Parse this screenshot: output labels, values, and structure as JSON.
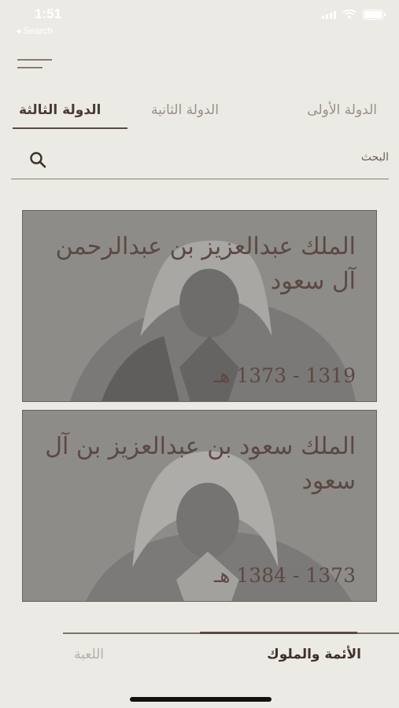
{
  "status_bar": {
    "time": "1:51",
    "back_label": "◂ Search"
  },
  "menu": {
    "icon": "hamburger-menu-icon"
  },
  "tabs": [
    {
      "label": "الدولة الأولى",
      "active": false
    },
    {
      "label": "الدولة الثانية",
      "active": false
    },
    {
      "label": "الدولة الثالثة",
      "active": true
    }
  ],
  "search": {
    "placeholder": "البحث",
    "icon": "search-icon"
  },
  "cards": [
    {
      "title": "الملك عبدالعزيز بن عبدالرحمن آل سعود",
      "years": "1319 - 1373 هـ"
    },
    {
      "title": "الملك سعود بن عبدالعزيز بن آل سعود",
      "years": "1373 - 1384 هـ"
    }
  ],
  "bottom_nav": {
    "items": [
      {
        "label": "الأئمة والملوك",
        "active": true
      },
      {
        "label": "اللعبة",
        "active": false
      }
    ]
  },
  "colors": {
    "background": "#eceae4",
    "accent": "#5a4a44",
    "card_overlay": "#8c8b88"
  }
}
